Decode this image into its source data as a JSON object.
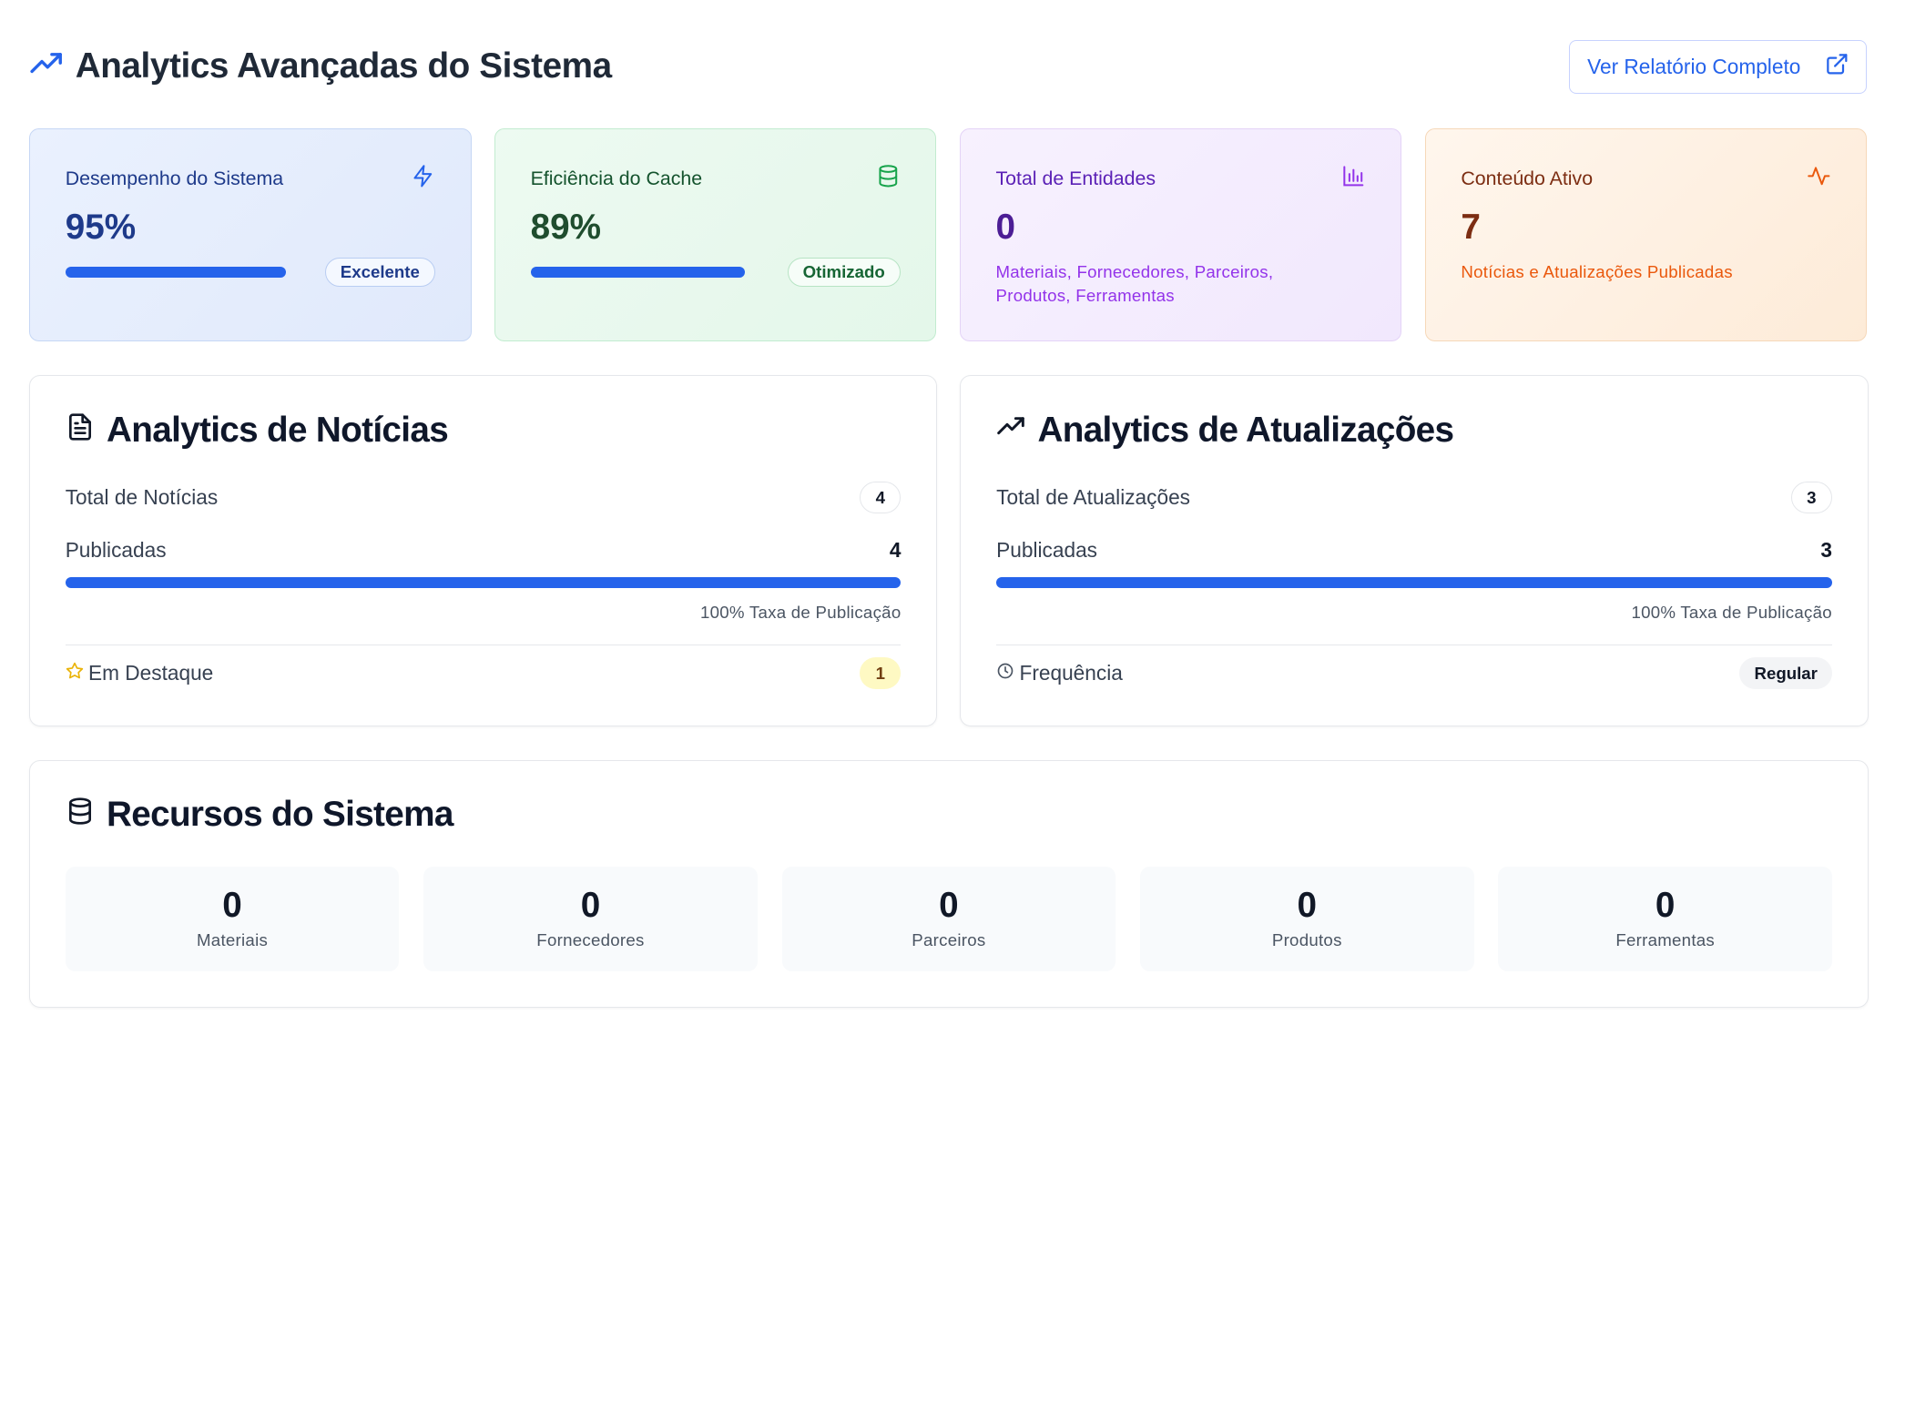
{
  "header": {
    "title": "Analytics Avançadas do Sistema",
    "report_button": "Ver Relatório Completo"
  },
  "stats": [
    {
      "title": "Desempenho do Sistema",
      "value": "95%",
      "progress": 0.95,
      "badge": "Excelente",
      "icon": "zap-icon"
    },
    {
      "title": "Eficiência do Cache",
      "value": "89%",
      "progress": 0.89,
      "badge": "Otimizado",
      "icon": "database-icon"
    },
    {
      "title": "Total de Entidades",
      "value": "0",
      "subtitle": "Materiais, Fornecedores, Parceiros, Produtos, Ferramentas",
      "icon": "bar-chart-icon"
    },
    {
      "title": "Conteúdo Ativo",
      "value": "7",
      "subtitle": "Notícias e Atualizações Publicadas",
      "icon": "activity-icon"
    }
  ],
  "news": {
    "title": "Analytics de Notícias",
    "total_label": "Total de Notícias",
    "total_value": "4",
    "published_label": "Publicadas",
    "published_value": "4",
    "published_progress": 1.0,
    "rate": "100% Taxa de Publicação",
    "featured_label": "Em Destaque",
    "featured_value": "1"
  },
  "updates": {
    "title": "Analytics de Atualizações",
    "total_label": "Total de Atualizações",
    "total_value": "3",
    "published_label": "Publicadas",
    "published_value": "3",
    "published_progress": 1.0,
    "rate": "100% Taxa de Publicação",
    "frequency_label": "Frequência",
    "frequency_value": "Regular"
  },
  "resources": {
    "title": "Recursos do Sistema",
    "items": [
      {
        "value": "0",
        "label": "Materiais"
      },
      {
        "value": "0",
        "label": "Fornecedores"
      },
      {
        "value": "0",
        "label": "Parceiros"
      },
      {
        "value": "0",
        "label": "Produtos"
      },
      {
        "value": "0",
        "label": "Ferramentas"
      }
    ]
  },
  "colors": {
    "accent": "#2563eb",
    "blue_card": "#eaf1fe",
    "green_card": "#edfaf1",
    "purple_card": "#f7f1fe",
    "orange_card": "#fff6ed"
  }
}
